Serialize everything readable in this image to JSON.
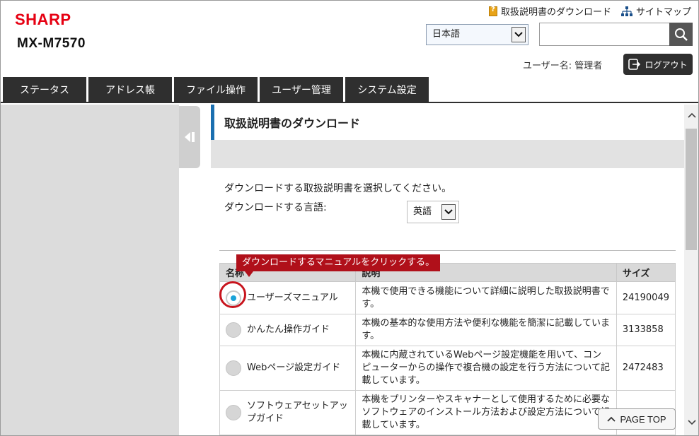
{
  "brand": {
    "logo": "SHARP",
    "model": "MX-M7570"
  },
  "header": {
    "manual_download_link": "取扱説明書のダウンロード",
    "sitemap_link": "サイトマップ",
    "language_selected": "日本語",
    "search_placeholder": "",
    "user_label": "ユーザー名: 管理者",
    "logout_label": "ログアウト"
  },
  "tabs": [
    {
      "label": "ステータス"
    },
    {
      "label": "アドレス帳"
    },
    {
      "label": "ファイル操作"
    },
    {
      "label": "ユーザー管理"
    },
    {
      "label": "システム設定"
    }
  ],
  "main": {
    "title": "取扱説明書のダウンロード",
    "instruction": "ダウンロードする取扱説明書を選択してください。",
    "language_label": "ダウンロードする言語:",
    "language_selected": "英語",
    "callout": "ダウンロードするマニュアルをクリックする。",
    "table": {
      "headers": {
        "name": "名称",
        "desc": "説明",
        "size": "サイズ"
      },
      "rows": [
        {
          "name": "ユーザーズマニュアル",
          "desc": "本機で使用できる機能について詳細に説明した取扱説明書です。",
          "size": "24190049",
          "selected": true
        },
        {
          "name": "かんたん操作ガイド",
          "desc": "本機の基本的な使用方法や便利な機能を簡潔に記載しています。",
          "size": "3133858",
          "selected": false
        },
        {
          "name": "Webページ設定ガイド",
          "desc": "本機に内蔵されているWebページ設定機能を用いて、コンピューターからの操作で複合機の設定を行う方法について記載しています。",
          "size": "2472483",
          "selected": false
        },
        {
          "name": "ソフトウェアセットアップガイド",
          "desc": "本機をプリンターやスキャナーとして使用するために必要なソフトウェアのインストール方法および設定方法について記載しています。",
          "size": "",
          "selected": false
        }
      ]
    }
  },
  "page_top_label": "PAGE TOP",
  "colors": {
    "brand_red": "#e60012",
    "accent_blue": "#1a6fb0",
    "callout_red": "#b0101a",
    "tab_dark": "#2f2f2f"
  }
}
